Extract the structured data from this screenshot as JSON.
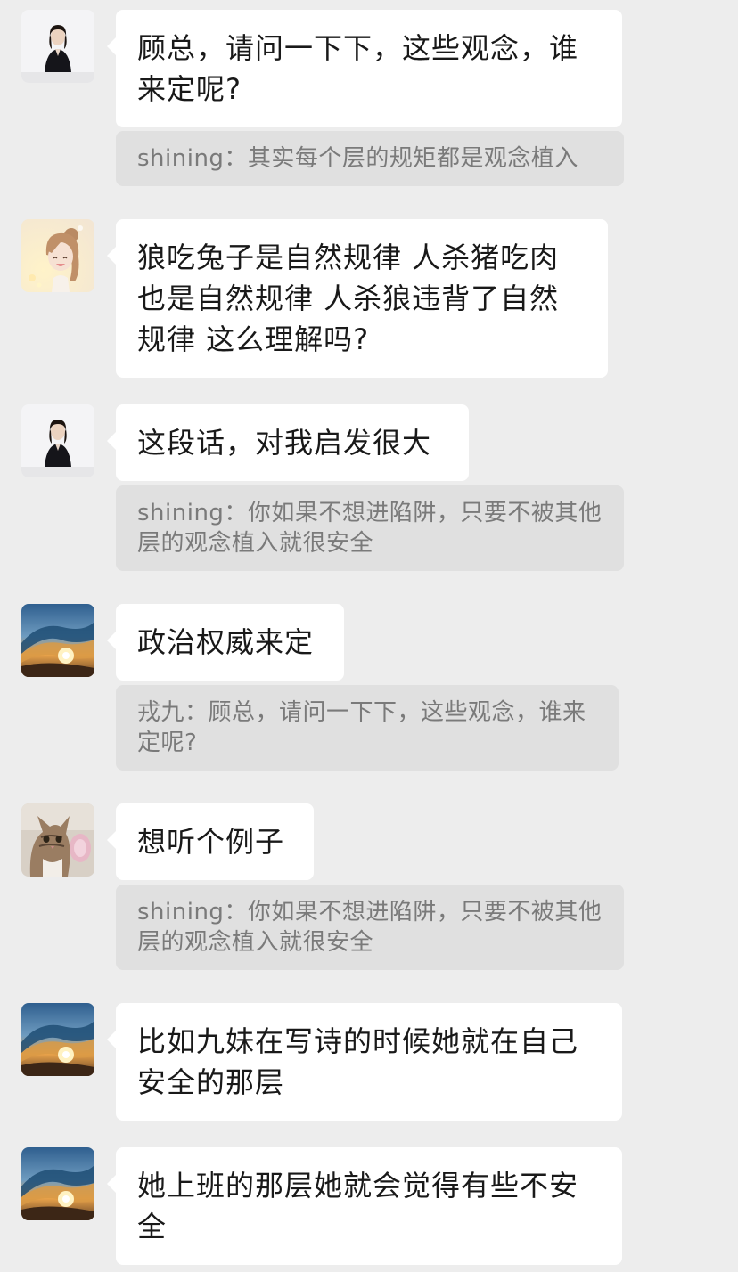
{
  "messages": [
    {
      "avatar": "woman-black-suit-avatar",
      "text": "顾总，请问一下下，这些观念，谁来定呢?",
      "quote": "shining：其实每个层的规矩都是观念植入"
    },
    {
      "avatar": "smiling-girl-illustration-avatar",
      "text": "狼吃兔子是自然规律 人杀猪吃肉 也是自然规律  人杀狼违背了自然规律 这么理解吗?",
      "quote": ""
    },
    {
      "avatar": "woman-black-suit-avatar",
      "text": "这段话，对我启发很大",
      "quote": "shining：你如果不想进陷阱，只要不被其他层的观念植入就很安全"
    },
    {
      "avatar": "ocean-wave-sunset-avatar",
      "text": "政治权威来定",
      "quote": "戎九：顾总，请问一下下，这些观念，谁来定呢?"
    },
    {
      "avatar": "cat-photo-avatar",
      "text": "想听个例子",
      "quote": "shining：你如果不想进陷阱，只要不被其他层的观念植入就很安全"
    },
    {
      "avatar": "ocean-wave-sunset-avatar",
      "text": "比如九妹在写诗的时候她就在自己安全的那层",
      "quote": ""
    },
    {
      "avatar": "ocean-wave-sunset-avatar",
      "text": "她上班的那层她就会觉得有些不安全",
      "quote": ""
    }
  ]
}
